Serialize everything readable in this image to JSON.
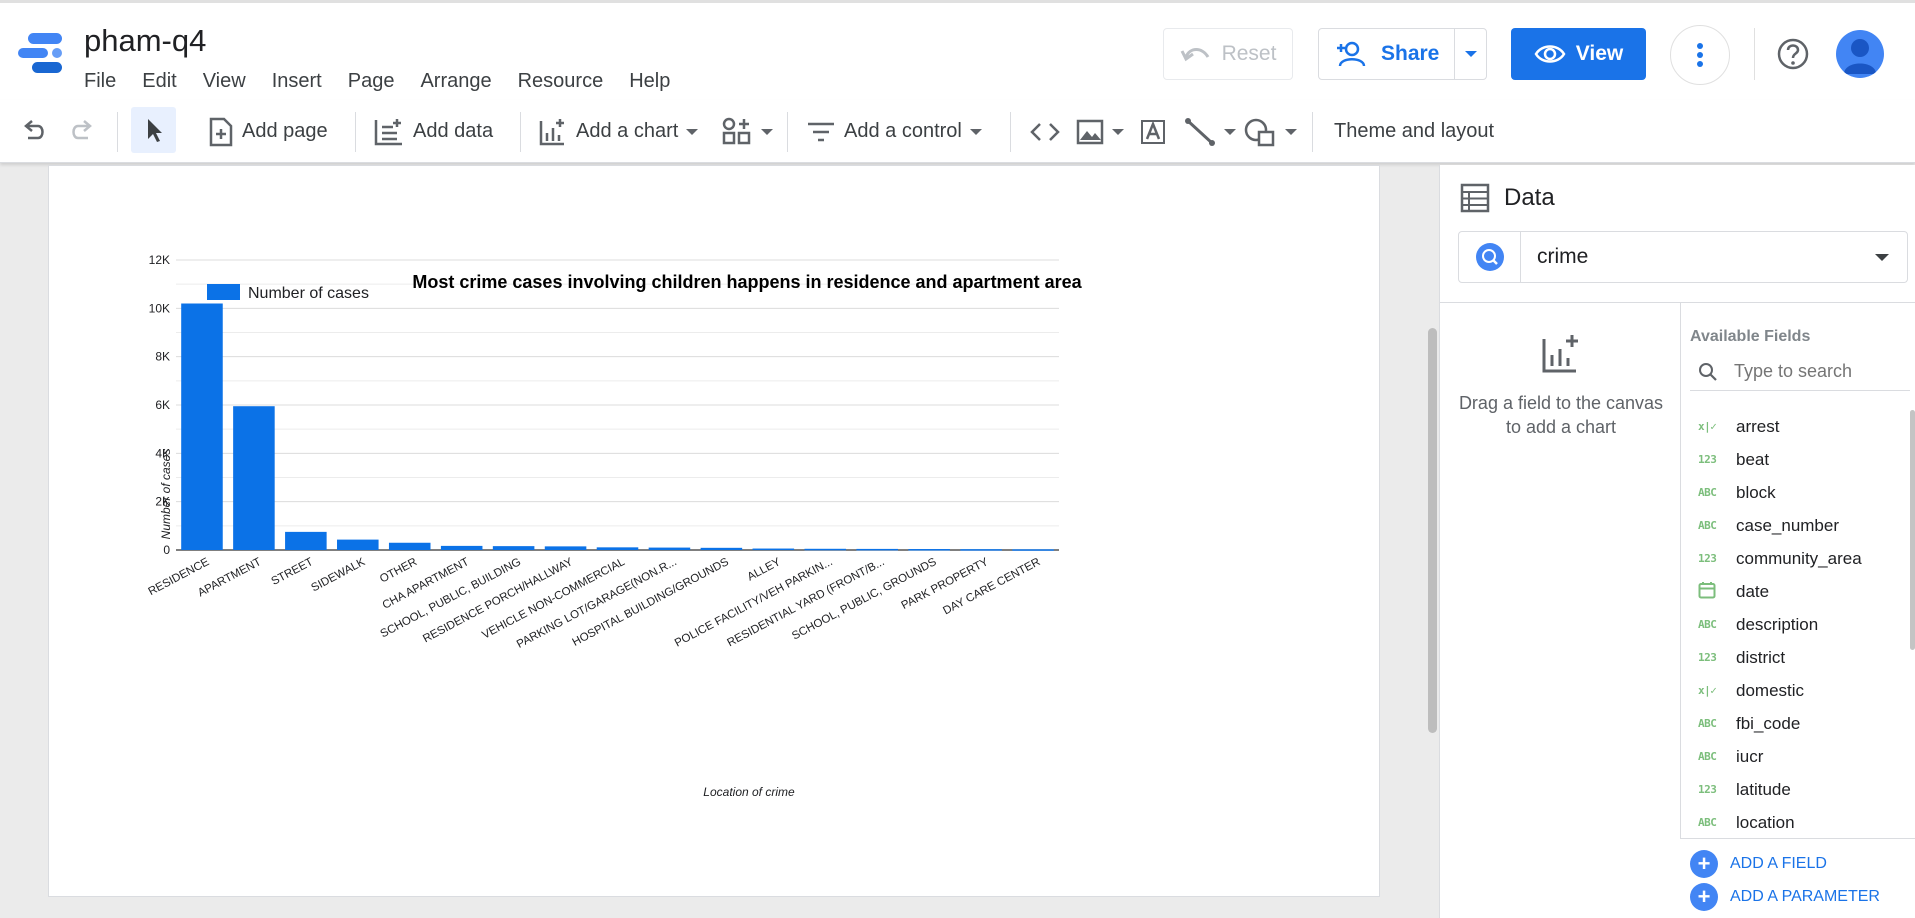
{
  "header": {
    "title": "pham-q4",
    "menu": [
      "File",
      "Edit",
      "View",
      "Insert",
      "Page",
      "Arrange",
      "Resource",
      "Help"
    ],
    "reset_label": "Reset",
    "share_label": "Share",
    "view_label": "View"
  },
  "toolbar": {
    "add_page": "Add page",
    "add_data": "Add data",
    "add_chart": "Add a chart",
    "add_control": "Add a control",
    "theme_layout": "Theme and layout"
  },
  "chart_data": {
    "type": "bar",
    "title": "Most crime cases involving children happens in residence and apartment area",
    "xlabel": "Location of crime",
    "ylabel": "Number of cases",
    "legend": "Number of cases",
    "legend_position": "top-left",
    "color": "#0b72e7",
    "grid": true,
    "ylim": [
      0,
      12000
    ],
    "yticks": [
      "0",
      "2K",
      "4K",
      "6K",
      "8K",
      "10K",
      "12K"
    ],
    "ytick_values": [
      0,
      2000,
      4000,
      6000,
      8000,
      10000,
      12000
    ],
    "categories": [
      "RESIDENCE",
      "APARTMENT",
      "STREET",
      "SIDEWALK",
      "OTHER",
      "CHA APARTMENT",
      "SCHOOL, PUBLIC, BUILDING",
      "RESIDENCE PORCH/HALLWAY",
      "VEHICLE NON-COMMERCIAL",
      "PARKING LOT/GARAGE(NON.R...",
      "HOSPITAL BUILDING/GROUNDS",
      "ALLEY",
      "POLICE FACILITY/VEH PARKIN...",
      "RESIDENTIAL YARD (FRONT/B...",
      "SCHOOL, PUBLIC, GROUNDS",
      "PARK PROPERTY",
      "DAY CARE CENTER"
    ],
    "values": [
      10200,
      5950,
      750,
      430,
      300,
      170,
      160,
      150,
      110,
      100,
      90,
      60,
      50,
      45,
      40,
      35,
      30
    ]
  },
  "data_panel": {
    "title": "Data",
    "source": "crime",
    "hint": "Drag a field to the canvas to add a chart",
    "available_label": "Available Fields",
    "search_placeholder": "Type to search",
    "fields": [
      {
        "type": "x|✓",
        "name": "arrest"
      },
      {
        "type": "123",
        "name": "beat"
      },
      {
        "type": "ABC",
        "name": "block"
      },
      {
        "type": "ABC",
        "name": "case_number"
      },
      {
        "type": "123",
        "name": "community_area"
      },
      {
        "type": "cal",
        "name": "date"
      },
      {
        "type": "ABC",
        "name": "description"
      },
      {
        "type": "123",
        "name": "district"
      },
      {
        "type": "x|✓",
        "name": "domestic"
      },
      {
        "type": "ABC",
        "name": "fbi_code"
      },
      {
        "type": "ABC",
        "name": "iucr"
      },
      {
        "type": "123",
        "name": "latitude"
      },
      {
        "type": "ABC",
        "name": "location"
      }
    ],
    "add_field": "ADD A FIELD",
    "add_parameter": "ADD A PARAMETER"
  }
}
